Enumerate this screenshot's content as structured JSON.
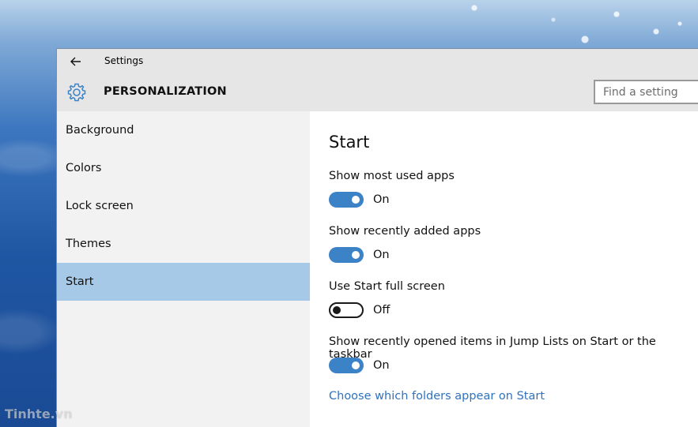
{
  "window": {
    "title": "Settings"
  },
  "header": {
    "title": "PERSONALIZATION",
    "search_placeholder": "Find a setting"
  },
  "sidebar": {
    "items": [
      {
        "label": "Background",
        "selected": false
      },
      {
        "label": "Colors",
        "selected": false
      },
      {
        "label": "Lock screen",
        "selected": false
      },
      {
        "label": "Themes",
        "selected": false
      },
      {
        "label": "Start",
        "selected": true
      }
    ]
  },
  "main": {
    "title": "Start",
    "settings": [
      {
        "label": "Show most used apps",
        "state": "On",
        "on": true
      },
      {
        "label": "Show recently added apps",
        "state": "On",
        "on": true
      },
      {
        "label": "Use Start full screen",
        "state": "Off",
        "on": false
      },
      {
        "label": "Show recently opened items in Jump Lists on Start or the taskbar",
        "state": "On",
        "on": true
      }
    ],
    "link": "Choose which folders appear on Start"
  },
  "watermark": "Tinhte.vn",
  "colors": {
    "accent": "#3c82c6",
    "selection": "#a6c9e8",
    "link": "#2e72c0"
  },
  "icons": {
    "back": "back-arrow-icon",
    "header": "gear-icon"
  }
}
